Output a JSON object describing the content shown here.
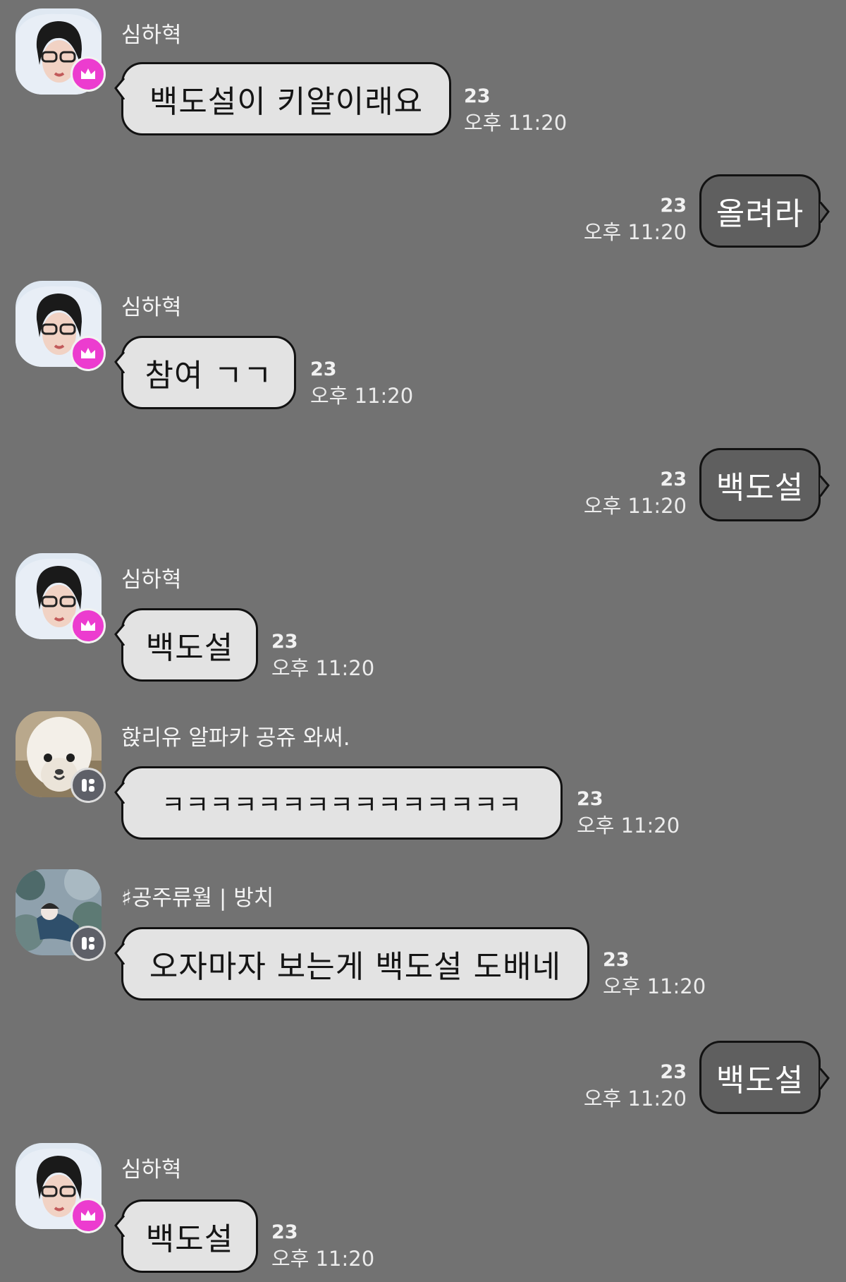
{
  "messages": [
    {
      "type": "in",
      "sender": "심하혁",
      "avatar": "boy-icon",
      "badge": "crown-icon",
      "text": "백도설이 키알이래요",
      "count": "23",
      "time": "오후 11:20"
    },
    {
      "type": "out",
      "text": "올려라",
      "count": "23",
      "time": "오후 11:20"
    },
    {
      "type": "in",
      "sender": "심하혁",
      "avatar": "boy-icon",
      "badge": "crown-icon",
      "text": "참여 ㄱㄱ",
      "count": "23",
      "time": "오후 11:20"
    },
    {
      "type": "out",
      "text": "백도설",
      "count": "23",
      "time": "오후 11:20"
    },
    {
      "type": "in",
      "sender": "심하혁",
      "avatar": "boy-icon",
      "badge": "crown-icon",
      "text": "백도설",
      "count": "23",
      "time": "오후 11:20"
    },
    {
      "type": "in",
      "sender": "핝리유 알파카 공쥬 와써.",
      "avatar": "alpaca-icon",
      "badge": "host-icon",
      "text": "ㅋㅋㅋㅋㅋㅋㅋㅋㅋㅋㅋㅋㅋㅋㅋ",
      "count": "23",
      "time": "오후 11:20"
    },
    {
      "type": "in",
      "sender": "♯공주류월 | 방치",
      "avatar": "photo-icon",
      "badge": "host-icon",
      "text": "오자마자 보는게 백도설 도배네",
      "count": "23",
      "time": "오후 11:20"
    },
    {
      "type": "out",
      "text": "백도설",
      "count": "23",
      "time": "오후 11:20"
    },
    {
      "type": "in",
      "sender": "심하혁",
      "avatar": "boy-icon",
      "badge": "crown-icon",
      "text": "백도설",
      "count": "23",
      "time": "오후 11:20"
    }
  ],
  "colors": {
    "background": "#727272",
    "bubble_in": "#e3e3e3",
    "bubble_out": "#5f5f5f",
    "crown_badge": "#ec3ccf",
    "host_badge": "#5e6068"
  }
}
